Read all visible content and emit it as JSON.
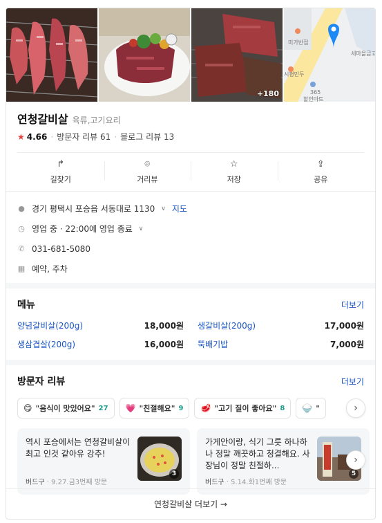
{
  "photos": {
    "badge": "+180",
    "map_labels": {
      "a": "미가반점",
      "b": "세마을금고",
      "c": "시평만두",
      "d": "365",
      "e": "할인마트"
    }
  },
  "place": {
    "name": "연청갈비살",
    "category": "육류,고기요리",
    "rating": "4.66",
    "visitor_reviews": "방문자 리뷰 61",
    "blog_reviews": "블로그 리뷰 13"
  },
  "actions": [
    {
      "icon": "directions-icon",
      "label": "길찾기"
    },
    {
      "icon": "street-view-icon",
      "label": "거리뷰"
    },
    {
      "icon": "star-icon",
      "label": "저장"
    },
    {
      "icon": "share-icon",
      "label": "공유"
    }
  ],
  "details": {
    "address": "경기 평택시 포승읍 서동대로 1130",
    "map_link": "지도",
    "hours": "영업 중 · 22:00에 영업 종료",
    "phone": "031-681-5080",
    "amenities": "예약, 주차"
  },
  "menu": {
    "title": "메뉴",
    "more": "더보기",
    "items": [
      {
        "name": "양념갈비살(200g)",
        "price": "18,000원"
      },
      {
        "name": "생갈비살(200g)",
        "price": "17,000원"
      },
      {
        "name": "생삼겹살(200g)",
        "price": "16,000원"
      },
      {
        "name": "뚝배기밥",
        "price": "7,000원"
      }
    ]
  },
  "visitor_reviews": {
    "title": "방문자 리뷰",
    "more": "더보기",
    "keywords": [
      {
        "emoji": "😋",
        "text": "\"음식이 맛있어요\"",
        "count": "27"
      },
      {
        "emoji": "💗",
        "text": "\"친절해요\"",
        "count": "9"
      },
      {
        "emoji": "🥩",
        "text": "\"고기 질이 좋아요\"",
        "count": "8"
      },
      {
        "emoji": "🍚",
        "text": "\"",
        "count": ""
      }
    ],
    "cards": [
      {
        "text": "역시 포승에서는 연청갈비살이 최고 인것 같아유 강추!",
        "author": "버드구",
        "meta": " · 9.27.금3번째 방문",
        "photo_count": "3"
      },
      {
        "text": "가게안이랑, 식기 그릇 하나하나 정말 깨끗하고 청결해요. 사장님이 정말 친절하...",
        "author": "버드구",
        "meta": " · 5.14.화1번째 방문",
        "photo_count": "5"
      }
    ]
  },
  "footer": {
    "label": "연청갈비살 더보기 →"
  },
  "colors": {
    "link": "#1a56c4",
    "star": "#e8413c",
    "count": "#1e9a8a"
  }
}
